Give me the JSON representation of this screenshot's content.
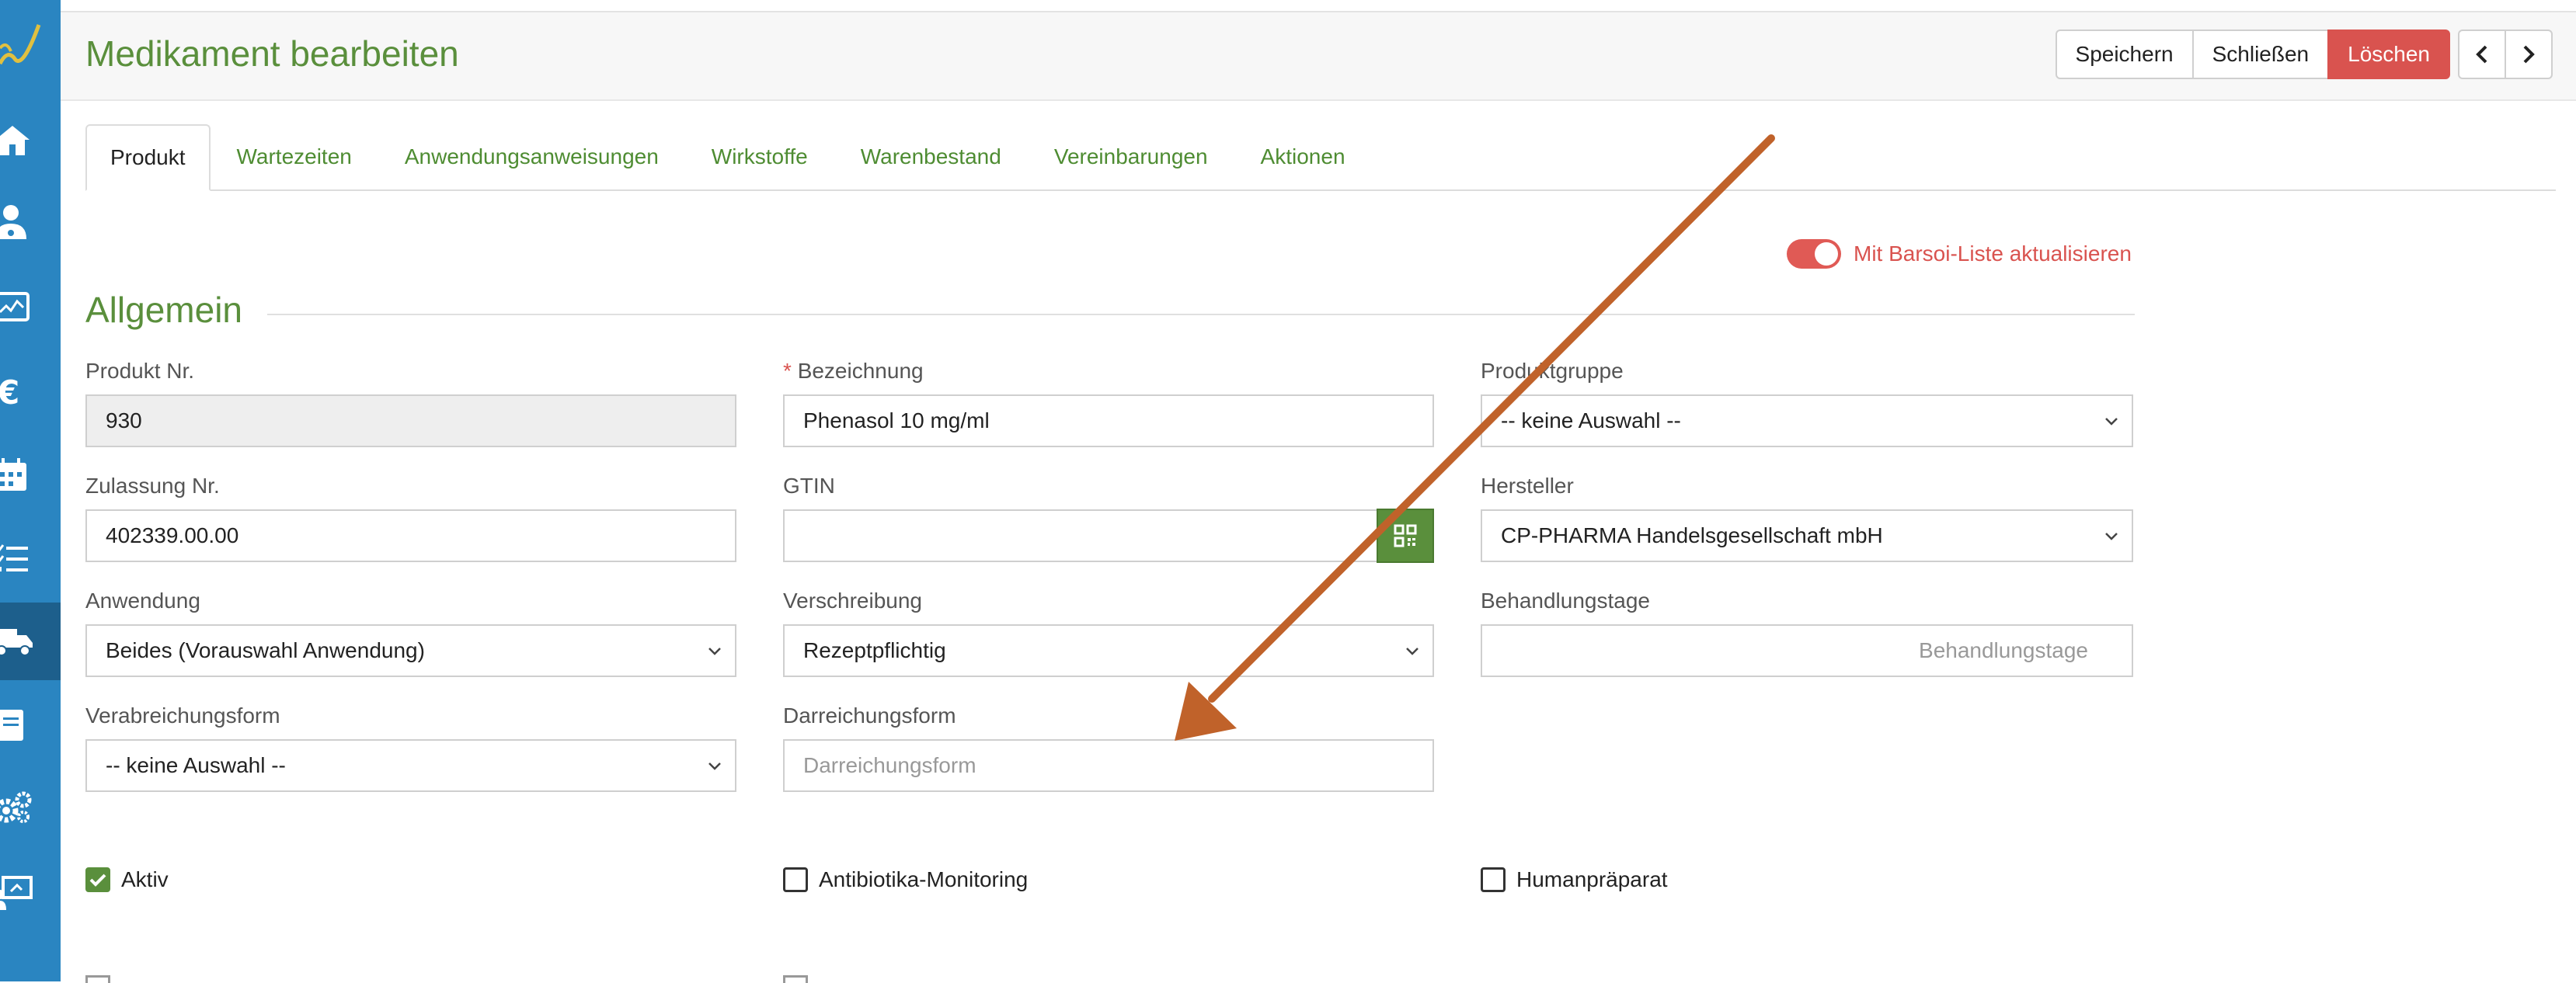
{
  "sidebar": {
    "items": [
      {
        "name": "sidebar-item-home",
        "icon": "home-icon"
      },
      {
        "name": "sidebar-item-patients",
        "icon": "doctor-icon"
      },
      {
        "name": "sidebar-item-monitor",
        "icon": "monitor-chart-icon"
      },
      {
        "name": "sidebar-item-finance",
        "icon": "euro-icon"
      },
      {
        "name": "sidebar-item-calendar",
        "icon": "calendar-icon"
      },
      {
        "name": "sidebar-item-tasks",
        "icon": "checklist-icon"
      },
      {
        "name": "sidebar-item-delivery",
        "icon": "truck-icon",
        "active": true
      },
      {
        "name": "sidebar-item-book",
        "icon": "book-icon"
      },
      {
        "name": "sidebar-item-settings",
        "icon": "gears-icon"
      },
      {
        "name": "sidebar-item-presentation",
        "icon": "presentation-icon"
      }
    ]
  },
  "header": {
    "title": "Medikament bearbeiten",
    "save_label": "Speichern",
    "close_label": "Schließen",
    "delete_label": "Löschen"
  },
  "tabs": [
    {
      "label": "Produkt",
      "active": true
    },
    {
      "label": "Wartezeiten"
    },
    {
      "label": "Anwendungsanweisungen"
    },
    {
      "label": "Wirkstoffe"
    },
    {
      "label": "Warenbestand"
    },
    {
      "label": "Vereinbarungen"
    },
    {
      "label": "Aktionen"
    }
  ],
  "toggle": {
    "label": "Mit Barsoi-Liste aktualisieren",
    "on": true
  },
  "section": {
    "title": "Allgemein"
  },
  "form": {
    "produkt_nr": {
      "label": "Produkt Nr.",
      "value": "930"
    },
    "bezeichnung": {
      "label": "Bezeichnung",
      "required_mark": "*",
      "value": "Phenasol 10 mg/ml"
    },
    "produktgruppe": {
      "label": "Produktgruppe",
      "value": "-- keine Auswahl --"
    },
    "zulassung_nr": {
      "label": "Zulassung Nr.",
      "value": "402339.00.00"
    },
    "gtin": {
      "label": "GTIN",
      "value": ""
    },
    "hersteller": {
      "label": "Hersteller",
      "value": "CP-PHARMA Handelsgesellschaft mbH"
    },
    "anwendung": {
      "label": "Anwendung",
      "value": "Beides (Vorauswahl Anwendung)"
    },
    "verschreibung": {
      "label": "Verschreibung",
      "value": "Rezeptpflichtig"
    },
    "behandlungstage": {
      "label": "Behandlungstage",
      "placeholder": "Behandlungstage"
    },
    "verabreichungsform": {
      "label": "Verabreichungsform",
      "value": "-- keine Auswahl --"
    },
    "darreichungsform": {
      "label": "Darreichungsform",
      "placeholder": "Darreichungsform"
    }
  },
  "checkboxes": [
    {
      "label": "Aktiv",
      "checked": true
    },
    {
      "label": "Antibiotika-Monitoring",
      "checked": false
    },
    {
      "label": "Humanpräparat",
      "checked": false
    }
  ],
  "colors": {
    "sidebar": "#2a85c1",
    "sidebar_active": "#1d5f8c",
    "accent_green": "#5a8f3c",
    "danger": "#d9534f",
    "annotation_arrow": "#c0622a"
  }
}
